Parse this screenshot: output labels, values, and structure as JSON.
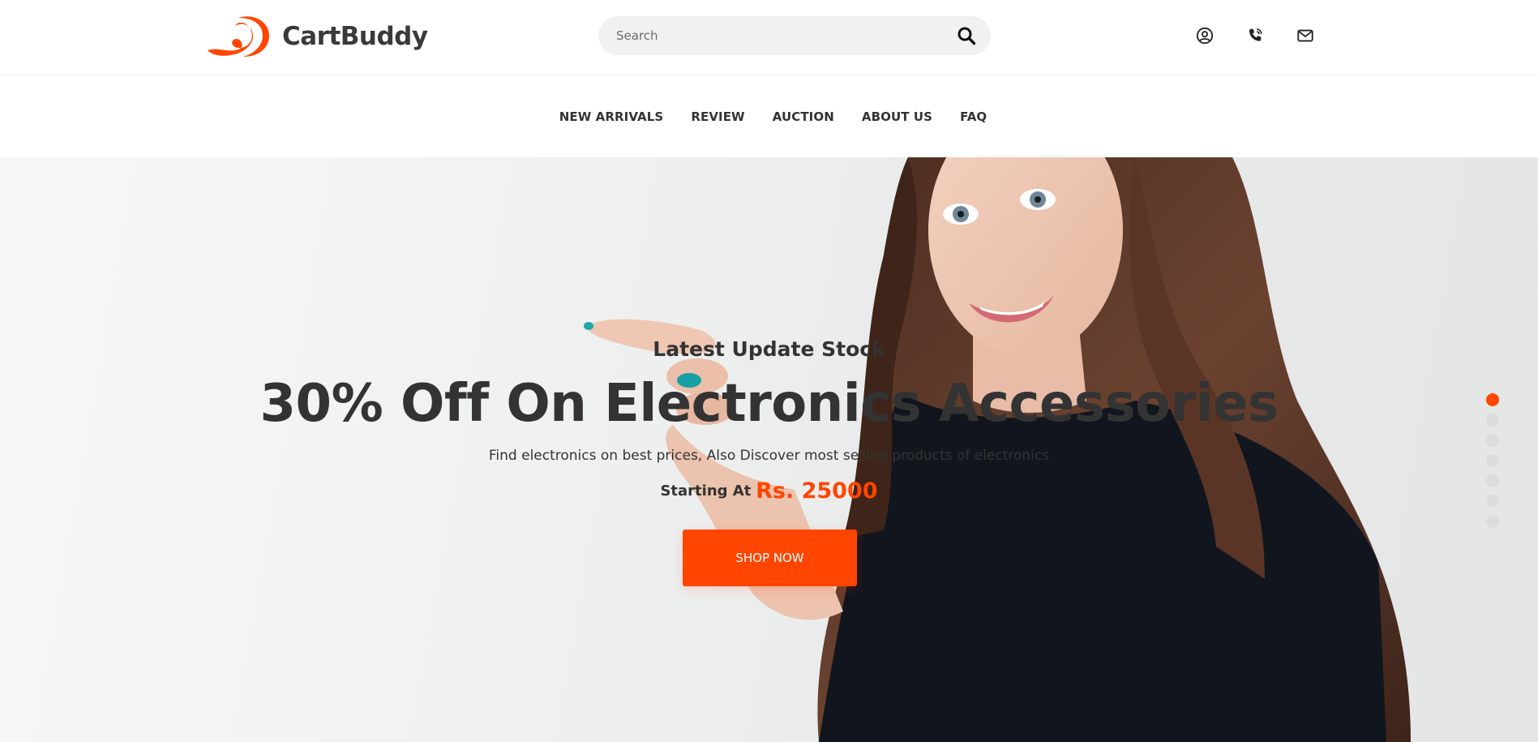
{
  "brand": {
    "name": "CartBuddy",
    "accent_color": "#ff4500"
  },
  "header": {
    "search": {
      "placeholder": "Search",
      "value": "",
      "icon": "search-icon"
    },
    "icons": [
      "user-icon",
      "phone-icon",
      "mail-icon"
    ]
  },
  "nav": {
    "items": [
      {
        "label": "NEW ARRIVALS"
      },
      {
        "label": "REVIEW"
      },
      {
        "label": "AUCTION"
      },
      {
        "label": "ABOUT US"
      },
      {
        "label": "FAQ"
      }
    ]
  },
  "hero": {
    "eyebrow": "Latest Update Stock",
    "headline": "30% Off On Electronics Accessories",
    "description": "Find electronics on best prices, Also Discover most selling products of electronics",
    "price_label": "Starting At",
    "price_value": "Rs. 25000",
    "cta_label": "SHOP NOW",
    "slides": {
      "count": 7,
      "active_index": 0
    }
  }
}
